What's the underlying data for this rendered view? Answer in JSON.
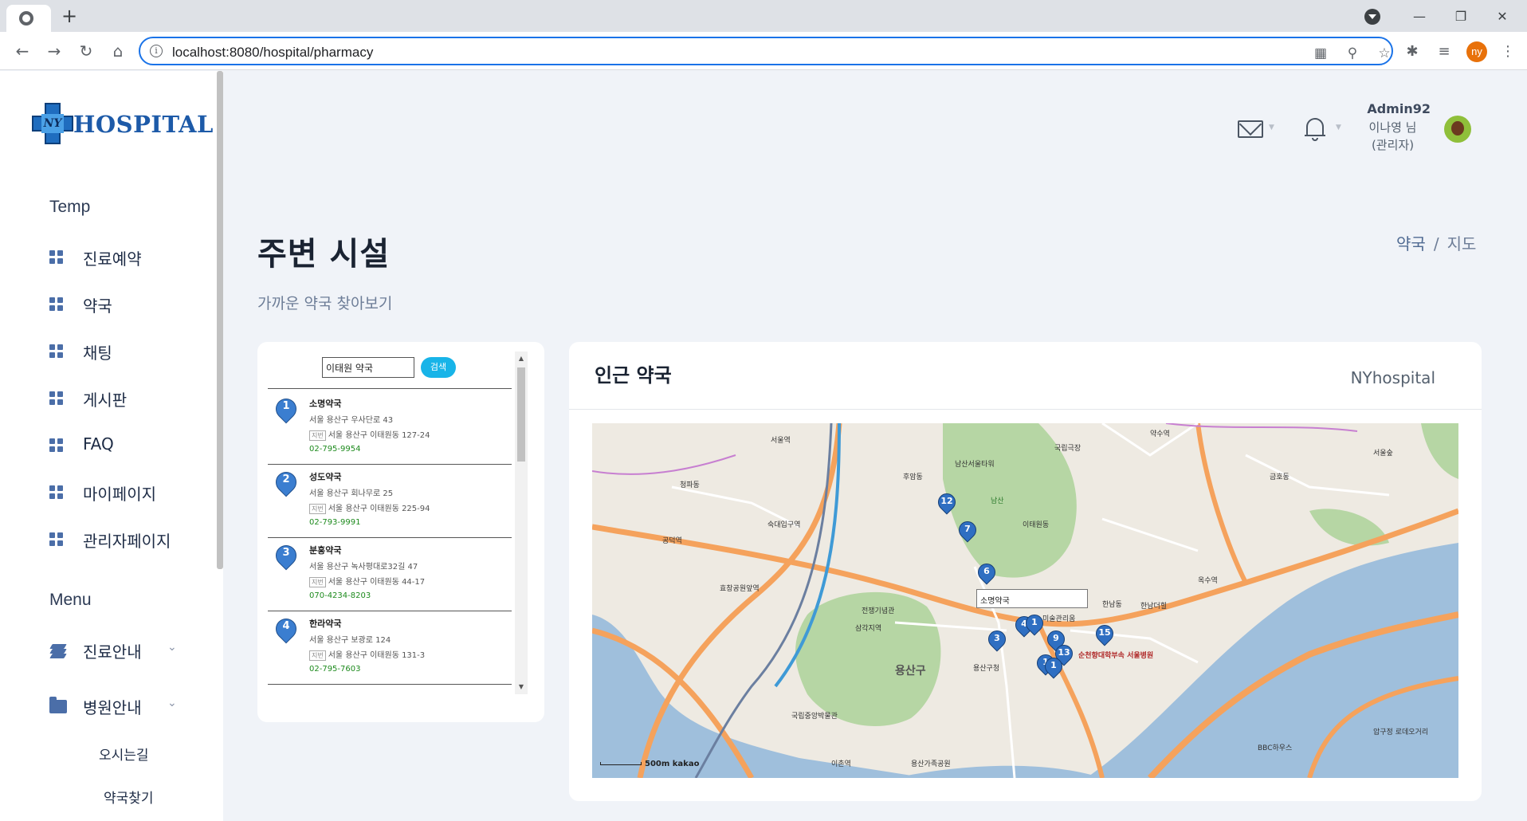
{
  "browser": {
    "url": "localhost:8080/hospital/pharmacy",
    "new_tab_label": "+",
    "profile_initials": "ny",
    "window_controls": [
      "—",
      "❐",
      "✕"
    ]
  },
  "sidebar": {
    "logo_text": "HOSPITAL",
    "logo_badge": "NY",
    "section_temp": "Temp",
    "temp_items": [
      {
        "label": "진료예약"
      },
      {
        "label": "약국"
      },
      {
        "label": "채팅"
      },
      {
        "label": "게시판"
      },
      {
        "label": "FAQ"
      },
      {
        "label": "마이페이지"
      },
      {
        "label": "관리자페이지"
      }
    ],
    "section_menu": "Menu",
    "menu_items": [
      {
        "label": "진료안내"
      },
      {
        "label": "병원안내"
      }
    ],
    "sub_items": [
      {
        "label": "오시는길"
      },
      {
        "label": "약국찾기"
      }
    ]
  },
  "header": {
    "user_id": "Admin92",
    "user_name": "이나영 님",
    "user_role": "(관리자)"
  },
  "page": {
    "title": "주변 시설",
    "subtitle": "가까운 약국 찾아보기",
    "breadcrumb": [
      "약국",
      "지도"
    ]
  },
  "search": {
    "value": "이태원 약국",
    "button_label": "검색"
  },
  "pharmacies": [
    {
      "num": "1",
      "name": "소명약국",
      "address": "서울 용산구 우사단로 43",
      "jibun": "서울 용산구 이태원동 127-24",
      "tel": "02-795-9954"
    },
    {
      "num": "2",
      "name": "성도약국",
      "address": "서울 용산구 회나무로 25",
      "jibun": "서울 용산구 이태원동 225-94",
      "tel": "02-793-9991"
    },
    {
      "num": "3",
      "name": "분홍약국",
      "address": "서울 용산구 녹사평대로32길 47",
      "jibun": "서울 용산구 이태원동 44-17",
      "tel": "070-4234-8203"
    },
    {
      "num": "4",
      "name": "한라약국",
      "address": "서울 용산구 보광로 124",
      "jibun": "서울 용산구 이태원동 131-3",
      "tel": "02-795-7603"
    }
  ],
  "jibun_tag": "지번",
  "map_card": {
    "title": "인근 약국",
    "brand": "NYhospital",
    "info_window": "소명약국",
    "scale": "500m",
    "provider": "kakao",
    "pins": [
      "12",
      "7",
      "6",
      "4",
      "1",
      "3",
      "9",
      "13",
      "1",
      "1",
      "15"
    ],
    "labels": {
      "area1": "용산구",
      "area2": "남산",
      "area3": "한남동",
      "area4": "이태원동",
      "station1": "서울역",
      "station2": "삼각지역",
      "station3": "공덕역",
      "station4": "옥수역",
      "station5": "이촌역",
      "station6": "숙대입구역",
      "station7": "효창공원앞역",
      "station8": "약수역",
      "poi1": "용산구청",
      "poi2": "순천향대학부속 서울병원",
      "poi3": "전쟁기념관",
      "poi4": "남산서울타워",
      "poi5": "국립극장",
      "poi6": "용산가족공원",
      "poi7": "미술관리움",
      "poi8": "한남더힐",
      "poi9": "국립중앙박물관",
      "poi10": "서울숲",
      "poi11": "금호동",
      "poi12": "BBC하우스",
      "poi13": "압구정 로데오거리",
      "poi14": "청파동",
      "poi15": "후암동"
    }
  }
}
